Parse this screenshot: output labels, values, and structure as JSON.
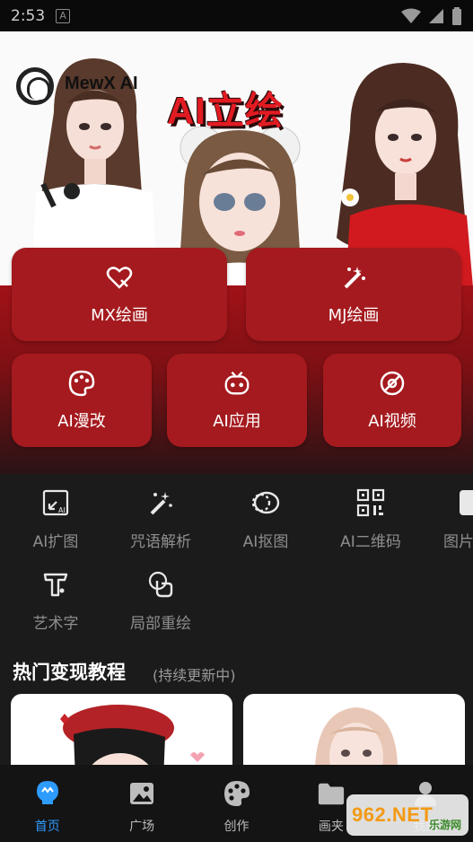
{
  "status_bar": {
    "time": "2:53",
    "notif_letter": "A"
  },
  "hero": {
    "app_name": "MewX AI",
    "title": "AI立绘"
  },
  "cards_row1": [
    {
      "label": "MX绘画",
      "icon": "heart-brush-icon"
    },
    {
      "label": "MJ绘画",
      "icon": "magic-wand-icon"
    }
  ],
  "cards_row2": [
    {
      "label": "AI漫改",
      "icon": "palette-icon"
    },
    {
      "label": "AI应用",
      "icon": "robot-icon"
    },
    {
      "label": "AI视频",
      "icon": "video-disc-icon"
    }
  ],
  "tools": [
    {
      "label": "AI扩图",
      "icon": "expand-image-icon"
    },
    {
      "label": "咒语解析",
      "icon": "magic-wand-icon"
    },
    {
      "label": "AI抠图",
      "icon": "cutout-icon"
    },
    {
      "label": "AI二维码",
      "icon": "qr-code-icon"
    },
    {
      "label": "图片",
      "icon": "image-icon"
    },
    {
      "label": "艺术字",
      "icon": "art-text-icon"
    },
    {
      "label": "局部重绘",
      "icon": "touch-redraw-icon"
    }
  ],
  "section": {
    "title": "热门变现教程",
    "subtitle": "(持续更新中)"
  },
  "bottom_nav": [
    {
      "label": "首页",
      "icon": "home-bulb-icon",
      "active": true
    },
    {
      "label": "广场",
      "icon": "gallery-icon",
      "active": false
    },
    {
      "label": "创作",
      "icon": "palette-icon",
      "active": false
    },
    {
      "label": "画夹",
      "icon": "folder-icon",
      "active": false
    },
    {
      "label": "我的",
      "icon": "person-icon",
      "active": false
    }
  ],
  "watermark": {
    "text": "962.NET",
    "sub": "乐游网"
  },
  "colors": {
    "card_red": "#a41a1e",
    "accent_blue": "#2e9bff",
    "background": "#1b1b1b"
  }
}
